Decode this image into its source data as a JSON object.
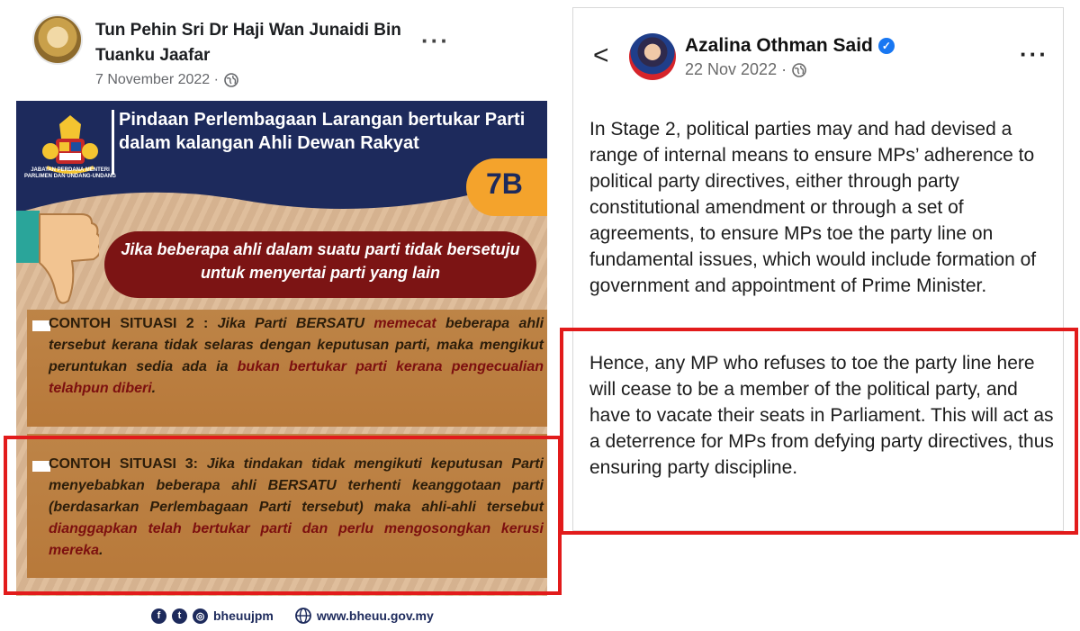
{
  "left_post": {
    "author": "Tun Pehin Sri Dr Haji Wan Junaidi Bin Tuanku Jaafar",
    "date": "7 November 2022 ·",
    "more_label": "···",
    "infographic": {
      "crest_caption": "JABATAN PERDANA MENTERI PARLIMEN DAN UNDANG-UNDANG",
      "title": "Pindaan Perlembagaan Larangan bertukar Parti dalam kalangan Ahli Dewan Rakyat",
      "badge": "7B",
      "banner": "Jika beberapa ahli dalam suatu parti tidak bersetuju untuk menyertai parti yang lain",
      "situation2": {
        "label": "CONTOH SITUASI 2 :",
        "t1": " Jika Parti BERSATU ",
        "h1": "memecat",
        "t2": " beberapa ahli tersebut kerana tidak selaras dengan keputusan parti, maka mengikut peruntukan sedia ada ia ",
        "h2": "bukan bertukar parti kerana pengecualian telahpun diberi",
        "t3": "."
      },
      "situation3": {
        "label": "CONTOH SITUASI 3:",
        "t1": " Jika tindakan tidak mengikuti keputusan Parti menyebabkan beberapa ahli BERSATU terhenti keanggotaan parti (berdasarkan Perlembagaan Parti tersebut) maka ahli-ahli tersebut ",
        "h1": "dianggapkan telah bertukar parti dan perlu mengosongkan kerusi mereka",
        "t2": "."
      },
      "footer_handle": "bheuujpm",
      "footer_website": "www.bheuu.gov.my"
    }
  },
  "right_post": {
    "back_label": "<",
    "author": "Azalina Othman Said",
    "date": "22 Nov 2022 ·",
    "more_label": "···",
    "para1": "In Stage 2, political parties may and had devised a range of internal means to ensure MPs’ adherence to political party directives, either through party constitutional amendment or through a set of agreements, to ensure MPs toe the party line on fundamental issues, which would include formation of government and appointment of Prime Minister.",
    "para2": "Hence, any MP who refuses to toe the party line here will cease to be a member of the political party, and have to vacate their seats in Parliament. This will act as a deterrence for MPs from defying party directives, thus ensuring party discipline."
  },
  "colors": {
    "highlight_frame": "#e21b1b",
    "navy": "#1d2a5c",
    "maroon": "#7c1414",
    "orange_badge": "#f4a32c",
    "verified_blue": "#1877f2"
  },
  "icons": [
    "globe-icon",
    "verified-icon",
    "back-arrow-icon",
    "more-icon",
    "thumbs-down-icon",
    "facebook-icon",
    "twitter-icon",
    "instagram-icon",
    "web-icon",
    "crest-icon"
  ]
}
